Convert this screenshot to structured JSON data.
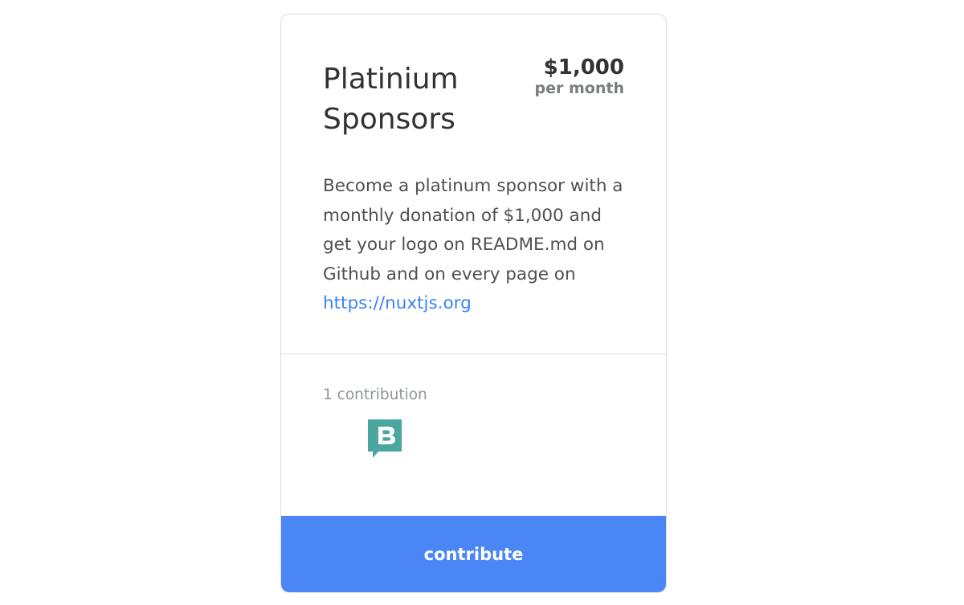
{
  "tier": {
    "title": "Platinium Sponsors",
    "price": "$1,000",
    "interval": "per month",
    "description": "Become a platinum sponsor with a monthly donation of $1,000 and get your logo on README.md on Github and on every page on",
    "link_text": "https://nuxtjs.org"
  },
  "contributions": {
    "count_label": "1 contribution",
    "avatars": [
      {
        "icon": "b-speech-bubble-logo",
        "color": "#4aa7a0"
      }
    ]
  },
  "actions": {
    "contribute_label": "contribute"
  },
  "colors": {
    "accent": "#4a86f5",
    "link": "#3a82f7",
    "logo": "#4aa7a0"
  }
}
